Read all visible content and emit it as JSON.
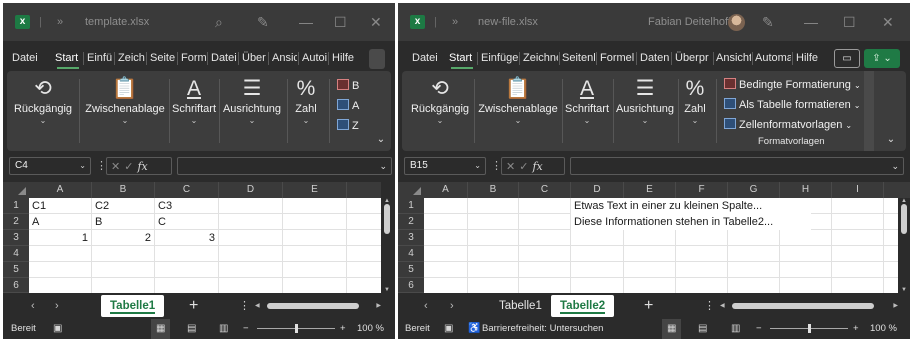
{
  "left": {
    "title": "template.xlsx",
    "menu": [
      "Datei",
      "Start",
      "Einfü",
      "Zeich",
      "Seite",
      "Form",
      "Datei",
      "Über",
      "Ansic",
      "Autoi",
      "Hilfe"
    ],
    "active_menu": "Start",
    "ribbon": {
      "undo": "Rückgängig",
      "clipboard": "Zwischenablage",
      "font": "Schriftart",
      "alignment": "Ausrichtung",
      "number": "Zahl",
      "styles_cut": [
        "B",
        "A",
        "Z"
      ]
    },
    "name_box": "C4",
    "columns": [
      "A",
      "B",
      "C",
      "D",
      "E"
    ],
    "rows": [
      "1",
      "2",
      "3",
      "4",
      "5",
      "6"
    ],
    "cells": {
      "A1": "C1",
      "B1": "C2",
      "C1": "C3",
      "A2": "A",
      "B2": "B",
      "C2": "C",
      "A3": "1",
      "B3": "2",
      "C3": "3"
    },
    "sheets": [
      "Tabelle1"
    ],
    "active_sheet": "Tabelle1",
    "status": {
      "ready": "Bereit",
      "zoom_minus": "−",
      "zoom_plus": "+",
      "zoom": "100 %"
    }
  },
  "right": {
    "title": "new-file.xlsx",
    "user": "Fabian Deitelhoff",
    "menu": [
      "Datei",
      "Start",
      "Einfüge",
      "Zeichne",
      "Seitenl",
      "Formel",
      "Daten",
      "Überpr",
      "Ansicht",
      "Automa",
      "Hilfe"
    ],
    "active_menu": "Start",
    "ribbon": {
      "undo": "Rückgängig",
      "clipboard": "Zwischenablage",
      "font": "Schriftart",
      "alignment": "Ausrichtung",
      "number": "Zahl",
      "cond_format": "Bedingte Formatierung",
      "as_table": "Als Tabelle formatieren",
      "cell_styles": "Zellenformatvorlagen",
      "styles_group": "Formatvorlagen"
    },
    "name_box": "B15",
    "columns": [
      "A",
      "B",
      "C",
      "D",
      "E",
      "F",
      "G",
      "H",
      "I"
    ],
    "rows": [
      "1",
      "2",
      "3",
      "4",
      "5",
      "6"
    ],
    "cells": {
      "D1": "Etwas Text in einer zu kleinen Spalte...",
      "D2": "Diese Informationen stehen in Tabelle2..."
    },
    "sheets": [
      "Tabelle1",
      "Tabelle2"
    ],
    "active_sheet": "Tabelle2",
    "status": {
      "ready": "Bereit",
      "accessibility": "Barrierefreiheit: Untersuchen",
      "zoom_minus": "−",
      "zoom_plus": "+",
      "zoom": "100 %"
    }
  },
  "colors": {
    "app_bg": "#2b2b2b",
    "ribbon_bg": "#3d3d3d",
    "accent_green": "#1f7a45",
    "grid_line": "#e1e1e1"
  },
  "icons": [
    "excel-logo",
    "more-icon",
    "search-icon",
    "pen-icon",
    "minimize-icon",
    "maximize-icon",
    "close-icon",
    "undo-icon",
    "paste-icon",
    "font-icon",
    "align-icon",
    "percent-icon",
    "comment-icon",
    "share-icon",
    "fx-icon",
    "cancel-icon",
    "check-icon",
    "normal-view-icon",
    "page-layout-icon",
    "page-break-icon",
    "accessibility-icon",
    "macro-icon"
  ]
}
